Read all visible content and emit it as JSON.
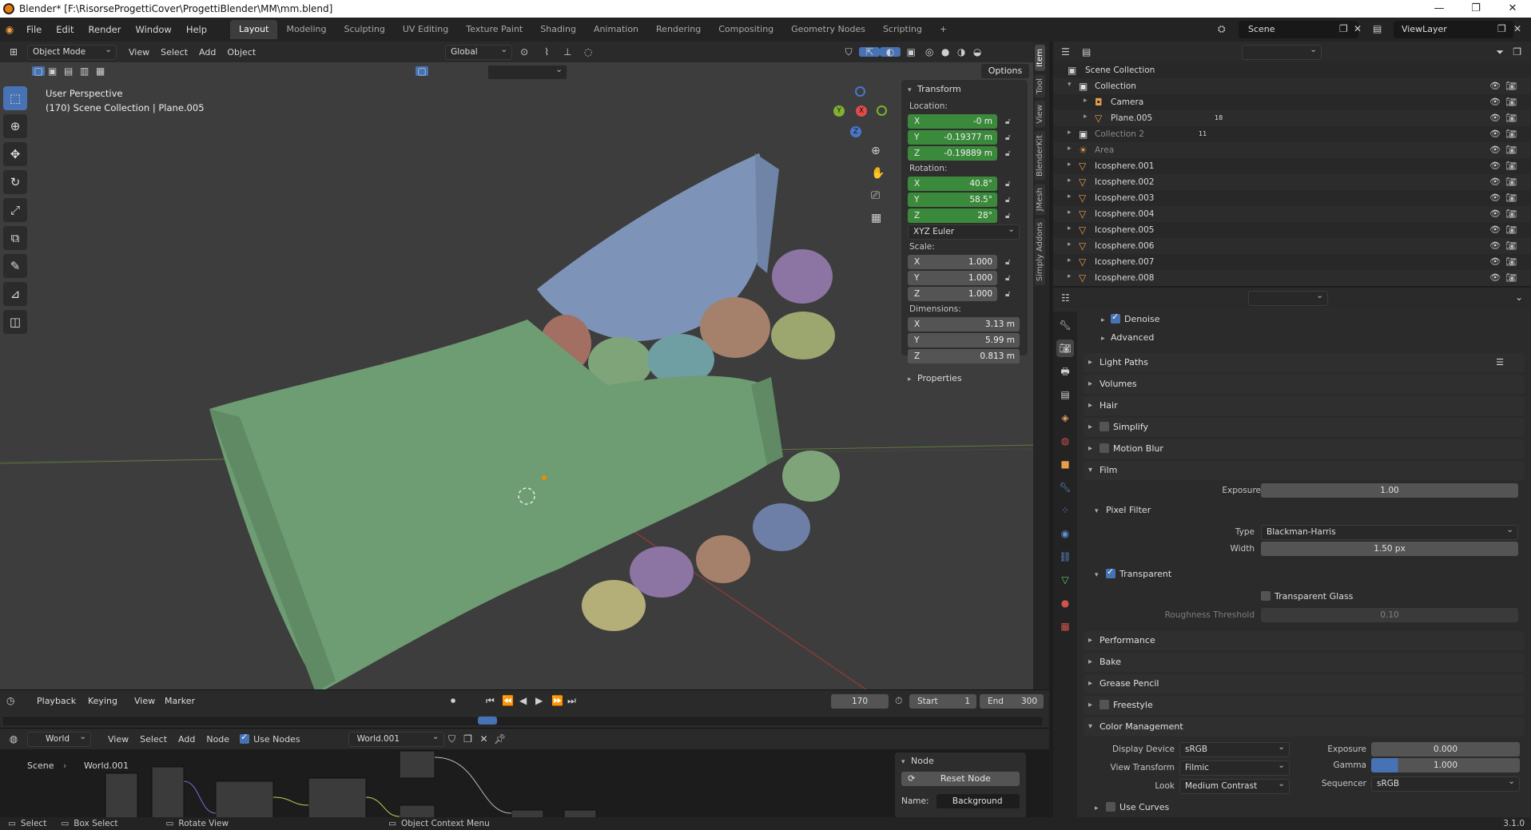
{
  "window": {
    "title": "Blender* [F:\\RisorseProgettiCover\\ProgettiBlender\\MM\\mm.blend]",
    "minimize": "—",
    "maximize": "❐",
    "close": "✕"
  },
  "menu": [
    "File",
    "Edit",
    "Render",
    "Window",
    "Help"
  ],
  "workspaces": [
    "Layout",
    "Modeling",
    "Sculpting",
    "UV Editing",
    "Texture Paint",
    "Shading",
    "Animation",
    "Rendering",
    "Compositing",
    "Geometry Nodes",
    "Scripting",
    "+"
  ],
  "scene": {
    "name": "Scene",
    "view_layer": "ViewLayer"
  },
  "viewport": {
    "mode": "Object Mode",
    "menus": [
      "View",
      "Select",
      "Add",
      "Object"
    ],
    "orientation": "Global",
    "options": "Options",
    "perspective": "User Perspective",
    "context": "(170) Scene Collection | Plane.005",
    "gizmo": {
      "x": "X",
      "y": "Y",
      "z": "Z"
    }
  },
  "npanel": {
    "header": "Transform",
    "location_label": "Location:",
    "location": [
      {
        "axis": "X",
        "value": "-0 m"
      },
      {
        "axis": "Y",
        "value": "-0.19377 m"
      },
      {
        "axis": "Z",
        "value": "-0.19889 m"
      }
    ],
    "rotation_label": "Rotation:",
    "rotation": [
      {
        "axis": "X",
        "value": "40.8°"
      },
      {
        "axis": "Y",
        "value": "58.5°"
      },
      {
        "axis": "Z",
        "value": "28°"
      }
    ],
    "rotation_mode": "XYZ Euler",
    "scale_label": "Scale:",
    "scale": [
      {
        "axis": "X",
        "value": "1.000"
      },
      {
        "axis": "Y",
        "value": "1.000"
      },
      {
        "axis": "Z",
        "value": "1.000"
      }
    ],
    "dimensions_label": "Dimensions:",
    "dimensions": [
      {
        "axis": "X",
        "value": "3.13 m"
      },
      {
        "axis": "Y",
        "value": "5.99 m"
      },
      {
        "axis": "Z",
        "value": "0.813 m"
      }
    ],
    "properties": "Properties",
    "tabs": [
      "Item",
      "Tool",
      "View",
      "BlenderKit",
      "JMesh",
      "Simply Addons"
    ]
  },
  "timeline": {
    "menus": [
      "Playback",
      "Keying",
      "View",
      "Marker"
    ],
    "current_frame": "170",
    "start_label": "Start",
    "start": "1",
    "end_label": "End",
    "end": "300"
  },
  "node_editor": {
    "type": "World",
    "menus": [
      "View",
      "Select",
      "Add",
      "Node"
    ],
    "use_nodes": "Use Nodes",
    "world": "World.001",
    "breadcrumb": [
      "Scene",
      "World.001"
    ],
    "panel_title": "Node",
    "reset": "Reset Node",
    "name_label": "Name:",
    "name_value": "Background"
  },
  "status": {
    "select": "Select",
    "box_select": "Box Select",
    "rotate": "Rotate View",
    "context_menu": "Object Context Menu",
    "version": "3.1.0"
  },
  "outliner": {
    "root": "Scene Collection",
    "items": [
      {
        "name": "Collection",
        "depth": 1,
        "dim": false
      },
      {
        "name": "Camera",
        "depth": 2,
        "dim": false
      },
      {
        "name": "Plane.005",
        "depth": 2,
        "dim": false,
        "badge": "18"
      },
      {
        "name": "Collection 2",
        "depth": 1,
        "dim": true,
        "badge": "11"
      },
      {
        "name": "Area",
        "depth": 1,
        "dim": true
      },
      {
        "name": "Icosphere.001",
        "depth": 1,
        "dim": false
      },
      {
        "name": "Icosphere.002",
        "depth": 1,
        "dim": false
      },
      {
        "name": "Icosphere.003",
        "depth": 1,
        "dim": false
      },
      {
        "name": "Icosphere.004",
        "depth": 1,
        "dim": false
      },
      {
        "name": "Icosphere.005",
        "depth": 1,
        "dim": false
      },
      {
        "name": "Icosphere.006",
        "depth": 1,
        "dim": false
      },
      {
        "name": "Icosphere.007",
        "depth": 1,
        "dim": false
      },
      {
        "name": "Icosphere.008",
        "depth": 1,
        "dim": false
      }
    ]
  },
  "properties": {
    "denoise": "Denoise",
    "advanced": "Advanced",
    "panels": [
      "Light Paths",
      "Volumes",
      "Hair",
      "Simplify",
      "Motion Blur",
      "Film"
    ],
    "film": {
      "exposure_label": "Exposure",
      "exposure": "1.00",
      "pixel_filter": "Pixel Filter",
      "type_label": "Type",
      "type": "Blackman-Harris",
      "width_label": "Width",
      "width": "1.50 px",
      "transparent": "Transparent",
      "transparent_glass": "Transparent Glass",
      "roughness_label": "Roughness Threshold",
      "roughness": "0.10"
    },
    "more_panels": [
      "Performance",
      "Bake",
      "Grease Pencil",
      "Freestyle"
    ],
    "color_management": {
      "title": "Color Management",
      "display_device_label": "Display Device",
      "display_device": "sRGB",
      "view_transform_label": "View Transform",
      "view_transform": "Filmic",
      "look_label": "Look",
      "look": "Medium Contrast",
      "exposure_label": "Exposure",
      "exposure": "0.000",
      "gamma_label": "Gamma",
      "gamma": "1.000",
      "sequencer_label": "Sequencer",
      "sequencer": "sRGB",
      "use_curves": "Use Curves"
    }
  },
  "colors": {
    "accent": "#4772b3",
    "green_field": "#3b8a3b",
    "viewport_bg": "#3d3d3d",
    "bag_green": "#6e9c73",
    "bag_blue": "#7d93b7"
  }
}
